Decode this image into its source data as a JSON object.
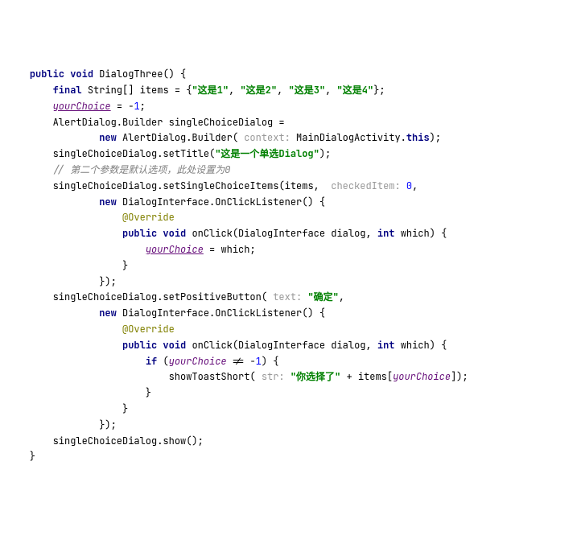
{
  "code": {
    "l1": {
      "kw1": "public",
      "kw2": "void",
      "name": "DialogThree"
    },
    "l2": {
      "kw1": "final",
      "type": "String",
      "name": "items",
      "s1": "\"这是1\"",
      "s2": "\"这是2\"",
      "s3": "\"这是3\"",
      "s4": "\"这是4\""
    },
    "l3": {
      "field": "yourChoice",
      "val": "1"
    },
    "l4": {
      "cls": "AlertDialog.Builder",
      "var": "singleChoiceDialog"
    },
    "l5": {
      "kw": "new",
      "cls": "AlertDialog.Builder",
      "hint": "context:",
      "target": "MainDialogActivity",
      "kw2": "this"
    },
    "l6": {
      "var": "singleChoiceDialog",
      "m": "setTitle",
      "s": "\"这是一个单选Dialog\""
    },
    "l7": {
      "cmt": "// 第二个参数是默认选项，此处设置为0"
    },
    "l8": {
      "var": "singleChoiceDialog",
      "m": "setSingleChoiceItems",
      "arg": "items",
      "hint": "checkedItem:",
      "val": "0"
    },
    "l9": {
      "kw": "new",
      "cls": "DialogInterface.OnClickListener"
    },
    "l10": {
      "ann": "@Override"
    },
    "l11": {
      "kw1": "public",
      "kw2": "void",
      "name": "onClick",
      "t1": "DialogInterface",
      "p1": "dialog",
      "kw3": "int",
      "p2": "which"
    },
    "l12": {
      "field": "yourChoice",
      "rhs": "which"
    },
    "l13": {
      "var": "singleChoiceDialog",
      "m": "setPositiveButton",
      "hint": "text:",
      "s": "\"确定\""
    },
    "l14": {
      "kw": "new",
      "cls": "DialogInterface.OnClickListener"
    },
    "l15": {
      "ann": "@Override"
    },
    "l16": {
      "kw1": "public",
      "kw2": "void",
      "name": "onClick",
      "t1": "DialogInterface",
      "p1": "dialog",
      "kw3": "int",
      "p2": "which"
    },
    "l17": {
      "kw": "if",
      "field": "yourChoice",
      "val": "1"
    },
    "l18": {
      "fn": "showToastShort",
      "hint": "str:",
      "s": "\"你选择了\"",
      "arr": "items",
      "idx": "yourChoice"
    },
    "l19": {
      "var": "singleChoiceDialog",
      "m": "show"
    }
  }
}
